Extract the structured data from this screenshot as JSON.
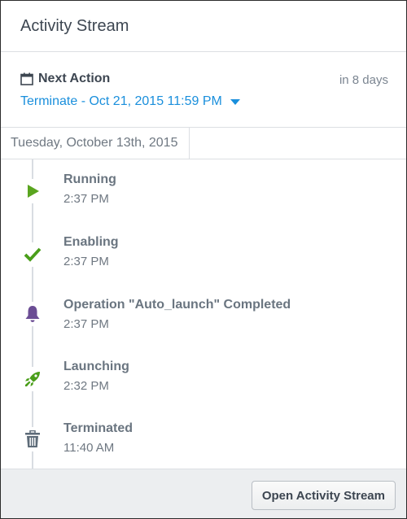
{
  "header": {
    "title": "Activity Stream"
  },
  "next_action": {
    "label": "Next Action",
    "relative_time": "in 8 days",
    "value": "Terminate - Oct 21, 2015 11:59 PM",
    "icon": "calendar-icon"
  },
  "date_header": "Tuesday, October 13th, 2015",
  "events": [
    {
      "title": "Running",
      "time": "2:37 PM",
      "icon": "play-icon",
      "color": "#5aa51f"
    },
    {
      "title": "Enabling",
      "time": "2:37 PM",
      "icon": "checkmark-icon",
      "color": "#4a9e1a"
    },
    {
      "title": "Operation \"Auto_launch\" Completed",
      "time": "2:37 PM",
      "icon": "bell-icon",
      "color": "#6b4d94"
    },
    {
      "title": "Launching",
      "time": "2:32 PM",
      "icon": "rocket-icon",
      "color": "#4a9e1a"
    },
    {
      "title": "Terminated",
      "time": "11:40 AM",
      "icon": "trash-icon",
      "color": "#5d6b78"
    }
  ],
  "footer": {
    "button_label": "Open Activity Stream"
  },
  "colors": {
    "link": "#1a8fdc",
    "text_dark": "#3d4651",
    "text_muted": "#6f7882",
    "border": "#dcdfe3",
    "footer_bg": "#eceef0"
  }
}
